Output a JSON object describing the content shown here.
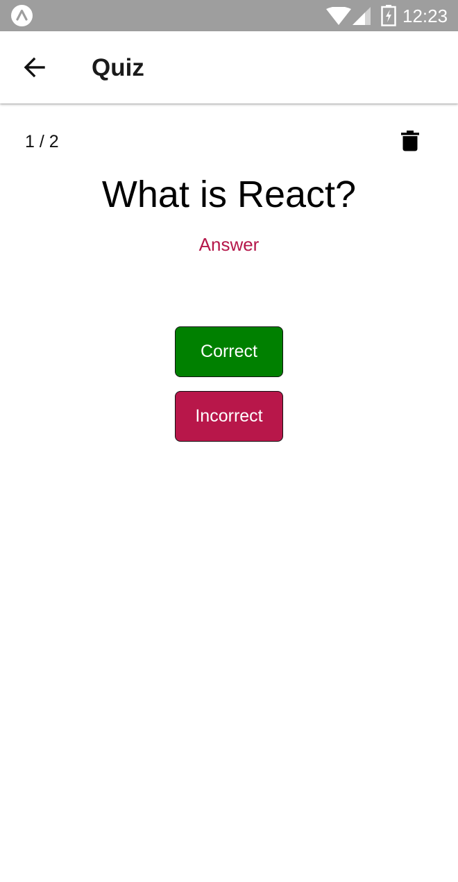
{
  "status_bar": {
    "time": "12:23",
    "icons": [
      "app-notification-icon",
      "wifi-icon",
      "cell-signal-icon",
      "battery-charging-icon"
    ],
    "background_color": "#9e9e9e"
  },
  "header": {
    "title": "Quiz",
    "back_icon": "arrow-left-icon"
  },
  "quiz": {
    "progress": "1 / 2",
    "delete_icon": "trash-icon",
    "question": "What is React?",
    "answer_label": "Answer",
    "answer_color": "#b5174a",
    "correct_label": "Correct",
    "correct_color": "#008000",
    "incorrect_label": "Incorrect",
    "incorrect_color": "#b8174a"
  }
}
